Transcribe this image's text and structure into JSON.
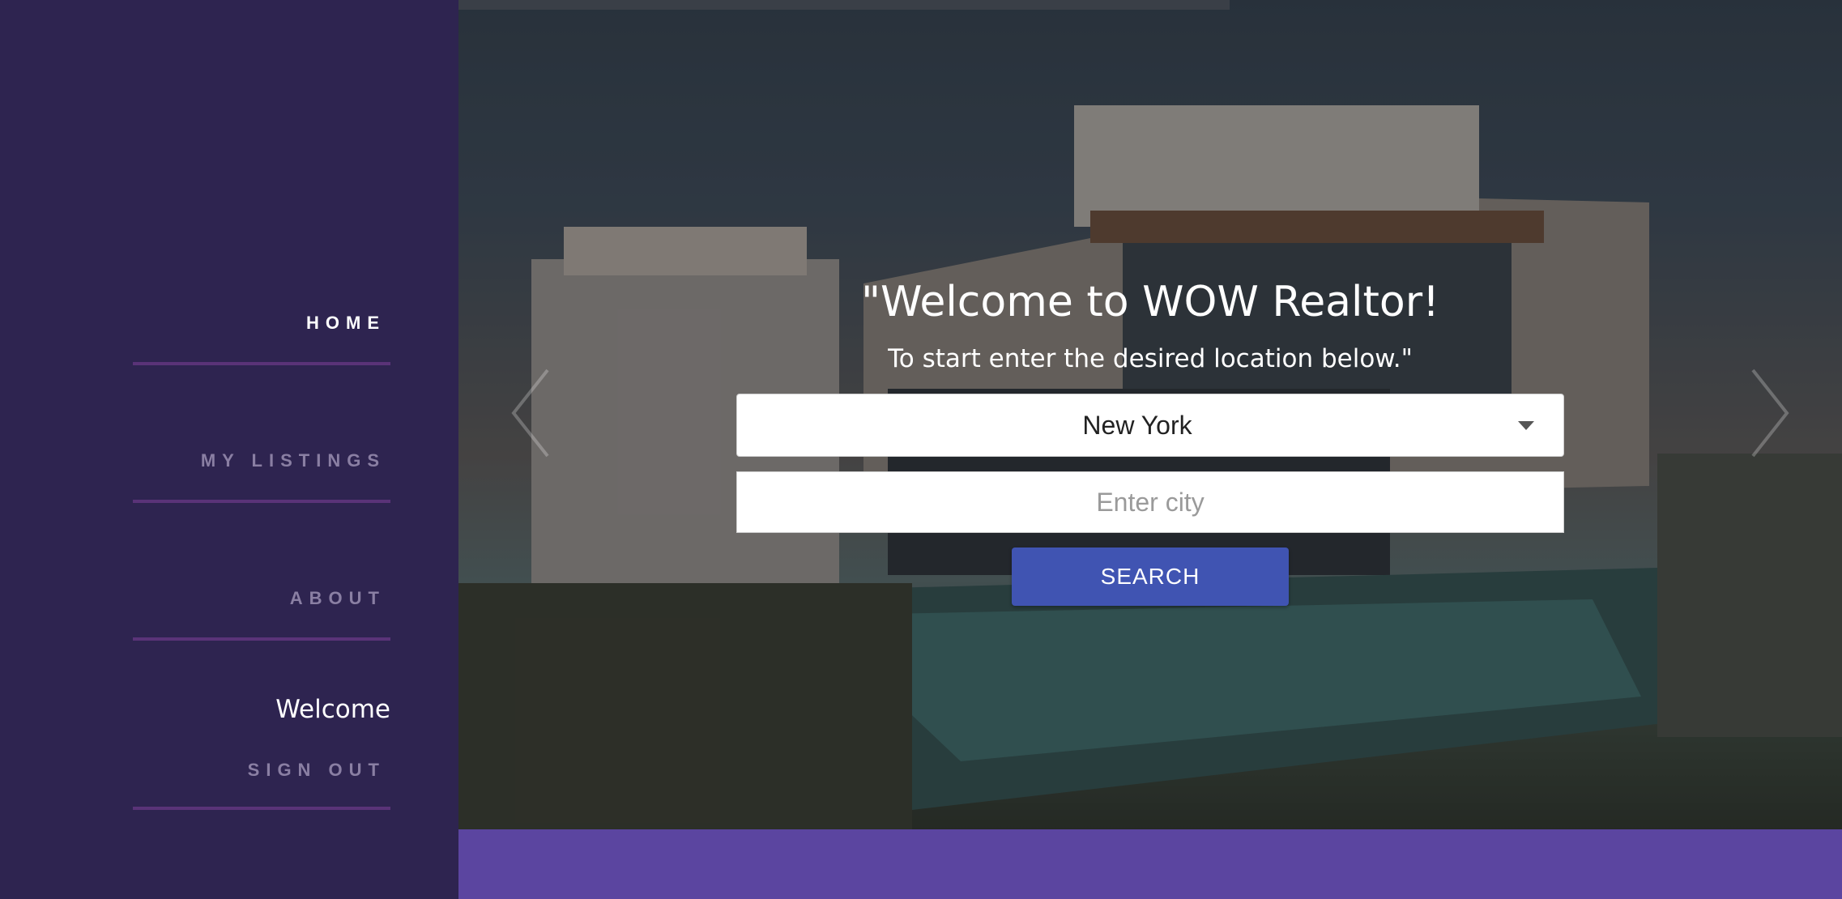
{
  "sidebar": {
    "nav": [
      {
        "label": "HOME",
        "active": true
      },
      {
        "label": "MY LISTINGS",
        "active": false
      },
      {
        "label": "ABOUT",
        "active": false
      }
    ],
    "welcome": "Welcome",
    "sign_out": "SIGN OUT"
  },
  "hero": {
    "title": "\"Welcome to WOW Realtor!",
    "subtitle": "To start enter the desired location below.\"",
    "location_select": {
      "value": "New York"
    },
    "city_input": {
      "placeholder": "Enter city",
      "value": ""
    },
    "search_label": "SEARCH",
    "prev_icon": "chevron-left-icon",
    "next_icon": "chevron-right-icon"
  },
  "colors": {
    "sidebar_bg": "#2e2450",
    "accent_underline": "#5a3378",
    "button": "#4054b2",
    "footer": "#5b45a0"
  }
}
